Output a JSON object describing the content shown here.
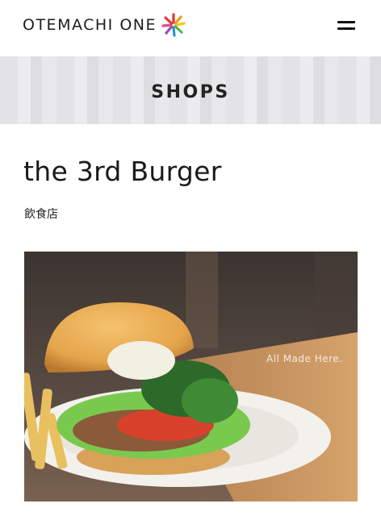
{
  "header": {
    "logo_text": "OTEMACHI ONE",
    "logo_icon": "pinwheel-icon",
    "menu_icon": "hamburger-menu-icon"
  },
  "section": {
    "title": "SHOPS"
  },
  "shop": {
    "name": "the 3rd Burger",
    "category": "飲食店",
    "photo_caption": "All Made Here."
  },
  "colors": {
    "band": "#e6e6e8",
    "text": "#1c1c1c",
    "logo_red": "#e4343a",
    "logo_orange": "#f39a1e",
    "logo_yellow": "#f2c81b",
    "logo_green": "#4db848",
    "logo_blue": "#2f8fd6",
    "logo_purple": "#8b4fb3",
    "logo_pink": "#e6498f"
  }
}
